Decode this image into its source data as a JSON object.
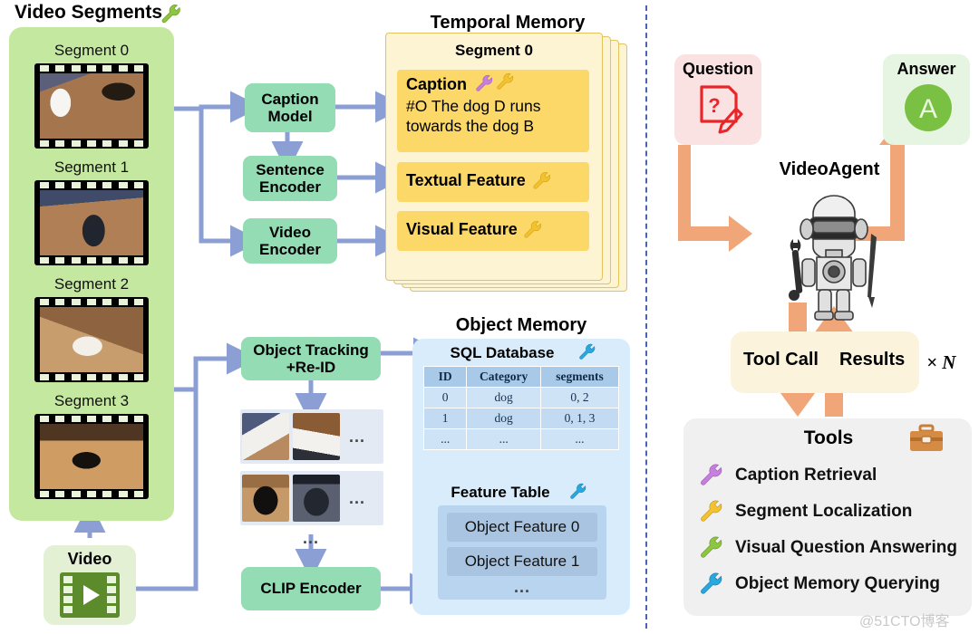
{
  "left": {
    "panel_title": "Video Segments",
    "panel_icon": "wrench-icon-green",
    "segments": [
      {
        "label": "Segment 0"
      },
      {
        "label": "Segment 1"
      },
      {
        "label": "Segment 2"
      },
      {
        "label": "Segment 3"
      }
    ],
    "video_box": {
      "label": "Video",
      "icon": "video-play-icon"
    },
    "modules": [
      {
        "id": "caption-model",
        "line1": "Caption",
        "line2": "Model"
      },
      {
        "id": "sentence-encoder",
        "line1": "Sentence",
        "line2": "Encoder"
      },
      {
        "id": "video-encoder",
        "line1": "Video",
        "line2": "Encoder"
      },
      {
        "id": "object-tracking",
        "line1": "Object Tracking",
        "line2": "+Re-ID"
      },
      {
        "id": "clip-encoder",
        "line1": "CLIP Encoder",
        "line2": ""
      }
    ],
    "ellipsis": "..."
  },
  "temporal_memory": {
    "title": "Temporal Memory",
    "card_title": "Segment 0",
    "caption_label": "Caption",
    "caption_icons": [
      "wrench-icon-purple",
      "wrench-icon-yellow"
    ],
    "caption_text": "#O The dog D runs towards the dog B",
    "textual_feature": "Textual Feature",
    "textual_icon": "wrench-icon-yellow",
    "visual_feature": "Visual Feature",
    "visual_icon": "wrench-icon-yellow"
  },
  "object_memory": {
    "title": "Object Memory",
    "sql_title": "SQL Database",
    "sql_icon": "wrench-icon-blue",
    "columns": [
      "ID",
      "Category",
      "segments"
    ],
    "rows": [
      [
        "0",
        "dog",
        "0, 2"
      ],
      [
        "1",
        "dog",
        "0, 1, 3"
      ],
      [
        "...",
        "...",
        "..."
      ]
    ],
    "feature_title": "Feature Table",
    "feature_icon": "wrench-icon-blue",
    "features": [
      "Object Feature 0",
      "Object Feature 1",
      "..."
    ]
  },
  "right": {
    "question": {
      "label": "Question",
      "icon": "question-note-pencil-icon"
    },
    "answer": {
      "label": "Answer",
      "icon": "answer-circle-icon",
      "letter": "A"
    },
    "agent": {
      "label": "VideoAgent",
      "icon": "robot-icon"
    },
    "loop": {
      "tool_call": "Tool Call",
      "results": "Results",
      "repeat": "× N"
    },
    "tools": {
      "title": "Tools",
      "icon": "toolbox-icon",
      "items": [
        {
          "label": "Caption Retrieval",
          "icon": "wrench-icon-purple",
          "color": "#c77ede"
        },
        {
          "label": "Segment Localization",
          "icon": "wrench-icon-yellow",
          "color": "#f2c230"
        },
        {
          "label": "Visual Question Answering",
          "icon": "wrench-icon-green",
          "color": "#8dc63f"
        },
        {
          "label": "Object Memory Querying",
          "icon": "wrench-icon-blue",
          "color": "#29a8e0"
        }
      ]
    }
  },
  "watermark": "@51CTO博客",
  "colors": {
    "module_green": "#93dcb4",
    "memory_yellow": "#fcd868",
    "memory_card": "#fdf4d4",
    "object_blue": "#d9ecfb",
    "arrow_blue": "#8b9fd4",
    "arrow_orange": "#f0a678",
    "panel_green": "#c5e8a0",
    "divider": "#4a63b8"
  }
}
